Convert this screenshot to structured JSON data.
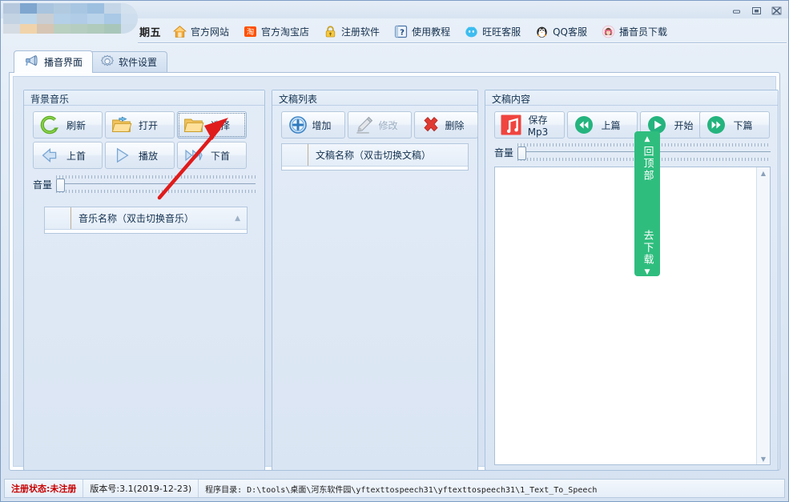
{
  "window": {
    "minimize_label": "minimize",
    "maximize_label": "maximize",
    "close_label": "close"
  },
  "topbar": {
    "day_text": "期五",
    "links": [
      {
        "label": "官方网站",
        "icon": "home-icon"
      },
      {
        "label": "官方淘宝店",
        "icon": "taobao-icon"
      },
      {
        "label": "注册软件",
        "icon": "lock-icon"
      },
      {
        "label": "使用教程",
        "icon": "help-icon"
      },
      {
        "label": "旺旺客服",
        "icon": "wangwang-icon"
      },
      {
        "label": "QQ客服",
        "icon": "qq-penguin-icon"
      },
      {
        "label": "播音员下载",
        "icon": "announcer-icon"
      }
    ]
  },
  "tabs": [
    {
      "label": "播音界面",
      "icon": "megaphone-icon",
      "active": true
    },
    {
      "label": "软件设置",
      "icon": "gear-icon",
      "active": false
    }
  ],
  "background_music": {
    "title": "背景音乐",
    "buttons": [
      {
        "label": "刷新",
        "icon": "refresh-icon",
        "state": "normal"
      },
      {
        "label": "打开",
        "icon": "folder-open-icon",
        "state": "normal"
      },
      {
        "label": "选择",
        "icon": "folder-icon",
        "state": "focused"
      },
      {
        "label": "上首",
        "icon": "prev-icon",
        "state": "normal"
      },
      {
        "label": "播放",
        "icon": "play-icon",
        "state": "normal"
      },
      {
        "label": "下首",
        "icon": "next-icon",
        "state": "normal"
      }
    ],
    "volume_label": "音量",
    "volume_value": 0,
    "list_header": "音乐名称（双击切换音乐）"
  },
  "script_list": {
    "title": "文稿列表",
    "buttons": [
      {
        "label": "增加",
        "icon": "plus-circle-icon",
        "state": "normal"
      },
      {
        "label": "修改",
        "icon": "pencil-icon",
        "state": "disabled"
      },
      {
        "label": "删除",
        "icon": "red-x-icon",
        "state": "normal"
      }
    ],
    "list_header": "文稿名称（双击切换文稿）"
  },
  "script_content": {
    "title": "文稿内容",
    "buttons": [
      {
        "label": "保存Mp3",
        "icon": "music-note-icon",
        "state": "normal"
      },
      {
        "label": "上篇",
        "icon": "rewind-icon",
        "state": "normal"
      },
      {
        "label": "开始",
        "icon": "play-circle-icon",
        "state": "normal"
      },
      {
        "label": "下篇",
        "icon": "forward-icon",
        "state": "normal"
      }
    ],
    "volume_label": "音量",
    "volume_value": 0,
    "editor_text": ""
  },
  "float_widget": {
    "up_arrow": "▲",
    "top_text": "回顶部",
    "download_text": "去下载",
    "down_arrow": "▼",
    "color": "#2fbd7e"
  },
  "statusbar": {
    "registration": "注册状态:未注册",
    "version": "版本号:3.1(2019-12-23)",
    "directory": "程序目录: D:\\tools\\桌面\\河东软件园\\yftexttospeech31\\yftexttospeech31\\1_Text_To_Speech"
  },
  "colors": {
    "accent_green": "#2fbd7e",
    "warn_red": "#c60000",
    "panel_blue": "#dae5f3",
    "border_blue": "#a9c2de"
  }
}
